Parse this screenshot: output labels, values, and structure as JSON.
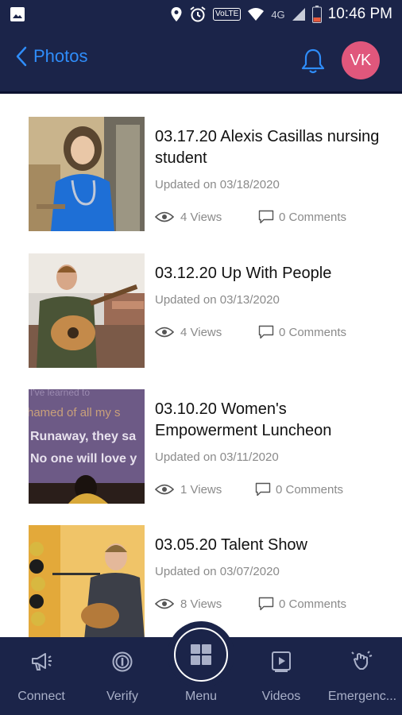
{
  "status_bar": {
    "time": "10:46 PM",
    "network": "4G",
    "volte": "VoLTE"
  },
  "header": {
    "back_label": "Photos",
    "avatar_initials": "VK"
  },
  "albums": [
    {
      "title": "03.17.20 Alexis Casillas nursing student",
      "updated": "Updated on 03/18/2020",
      "views": "4 Views",
      "comments": "0 Comments"
    },
    {
      "title": "03.12.20 Up With People",
      "updated": "Updated on 03/13/2020",
      "views": "4 Views",
      "comments": "0 Comments"
    },
    {
      "title": "03.10.20 Women's Empowerment Luncheon",
      "updated": "Updated on 03/11/2020",
      "views": "1 Views",
      "comments": "0 Comments"
    },
    {
      "title": "03.05.20 Talent Show",
      "updated": "Updated on 03/07/2020",
      "views": "8 Views",
      "comments": "0 Comments"
    }
  ],
  "thumb_text": {
    "line1": "I've learned to",
    "line2": "hamed of all my s",
    "line3": "Runaway, they sa",
    "line4": "No one will love y"
  },
  "bottom_nav": {
    "connect": "Connect",
    "verify": "Verify",
    "menu": "Menu",
    "videos": "Videos",
    "emergency": "Emergenc..."
  },
  "colors": {
    "navy": "#1b2449",
    "accent_blue": "#2f8dfa",
    "avatar": "#e0577c"
  }
}
